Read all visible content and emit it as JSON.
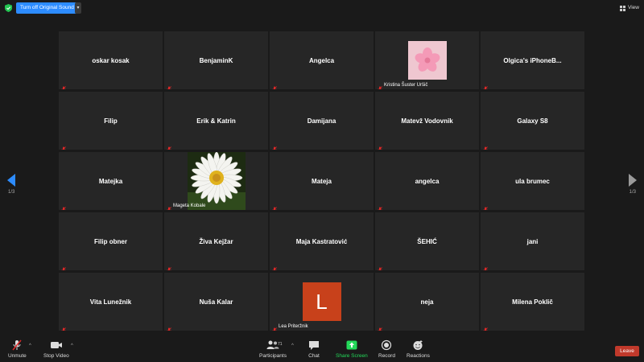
{
  "top": {
    "original_sound_label": "Turn off Original Sound",
    "caret": "▾",
    "view_label": "View"
  },
  "pagination": {
    "left": "1/3",
    "right": "1/3"
  },
  "participants": [
    {
      "name": "oskar kosak",
      "type": "name"
    },
    {
      "name": "BenjaminK",
      "type": "name"
    },
    {
      "name": "Angelca",
      "type": "name"
    },
    {
      "name": "Kristina Šuster Uršič",
      "type": "pink-photo"
    },
    {
      "name": "Olgica's iPhoneB...",
      "type": "name"
    },
    {
      "name": "Filip",
      "type": "name"
    },
    {
      "name": "Erik & Katrin",
      "type": "name"
    },
    {
      "name": "Damijana",
      "type": "name"
    },
    {
      "name": "Matevž Vodovnik",
      "type": "name"
    },
    {
      "name": "Galaxy S8",
      "type": "name"
    },
    {
      "name": "Matejka",
      "type": "name"
    },
    {
      "name": "Mageta Kobale",
      "type": "daisy-photo"
    },
    {
      "name": "Mateja",
      "type": "name"
    },
    {
      "name": "angelca",
      "type": "name"
    },
    {
      "name": "ula brumec",
      "type": "name"
    },
    {
      "name": "Filip obner",
      "type": "name"
    },
    {
      "name": "Živa Kejžar",
      "type": "name"
    },
    {
      "name": "Maja Kastratović",
      "type": "name"
    },
    {
      "name": "ŠEHIĆ",
      "type": "name"
    },
    {
      "name": "jani",
      "type": "name"
    },
    {
      "name": "Vita Lunežnik",
      "type": "name"
    },
    {
      "name": "Nuša Kalar",
      "type": "name"
    },
    {
      "name": "Lea Priteržnik",
      "type": "letter-avatar",
      "letter": "L"
    },
    {
      "name": "neja",
      "type": "name"
    },
    {
      "name": "Milena Poklič",
      "type": "name"
    }
  ],
  "toolbar": {
    "unmute": "Unmute",
    "stop_video": "Stop Video",
    "participants": "Participants",
    "participants_count": "71",
    "chat": "Chat",
    "share_screen": "Share Screen",
    "record": "Record",
    "reactions": "Reactions",
    "leave": "Leave",
    "caret": "^"
  },
  "colors": {
    "accent": "#2d8cff",
    "share_green": "#23d959",
    "leave_red": "#c0392b",
    "mute_red": "#e02828",
    "avatar_orange": "#c8411b",
    "tile_bg": "#262626"
  }
}
